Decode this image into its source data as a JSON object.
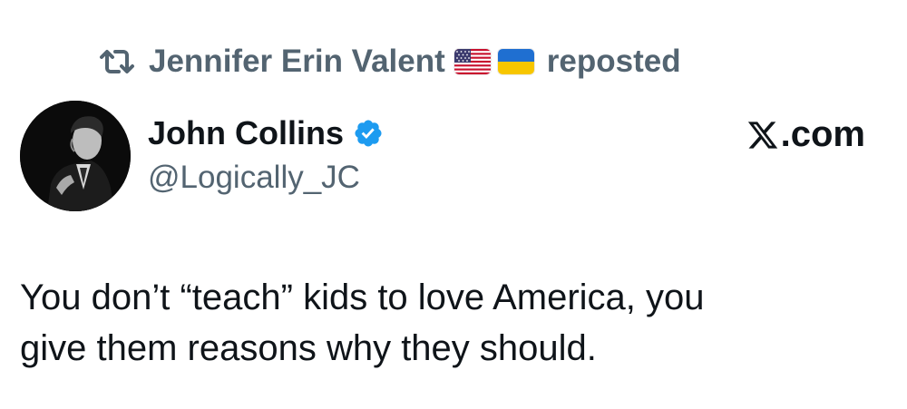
{
  "repost": {
    "icon": "repost-icon",
    "reposter_name": "Jennifer Erin Valent",
    "flags": [
      "us-flag-emoji",
      "ukraine-flag-emoji"
    ],
    "label": "reposted"
  },
  "author": {
    "display_name": "John Collins",
    "verified": true,
    "verified_color": "#1d9bf0",
    "handle": "@Logically_JC"
  },
  "brand": {
    "logo_icon": "x-logo-icon",
    "label": ".com"
  },
  "tweet": {
    "lines": [
      "You don’t “teach” kids to love America, you",
      "give them reasons why they should."
    ]
  },
  "colors": {
    "primary_text": "#0f1419",
    "secondary_text": "#536471",
    "background": "#ffffff"
  }
}
